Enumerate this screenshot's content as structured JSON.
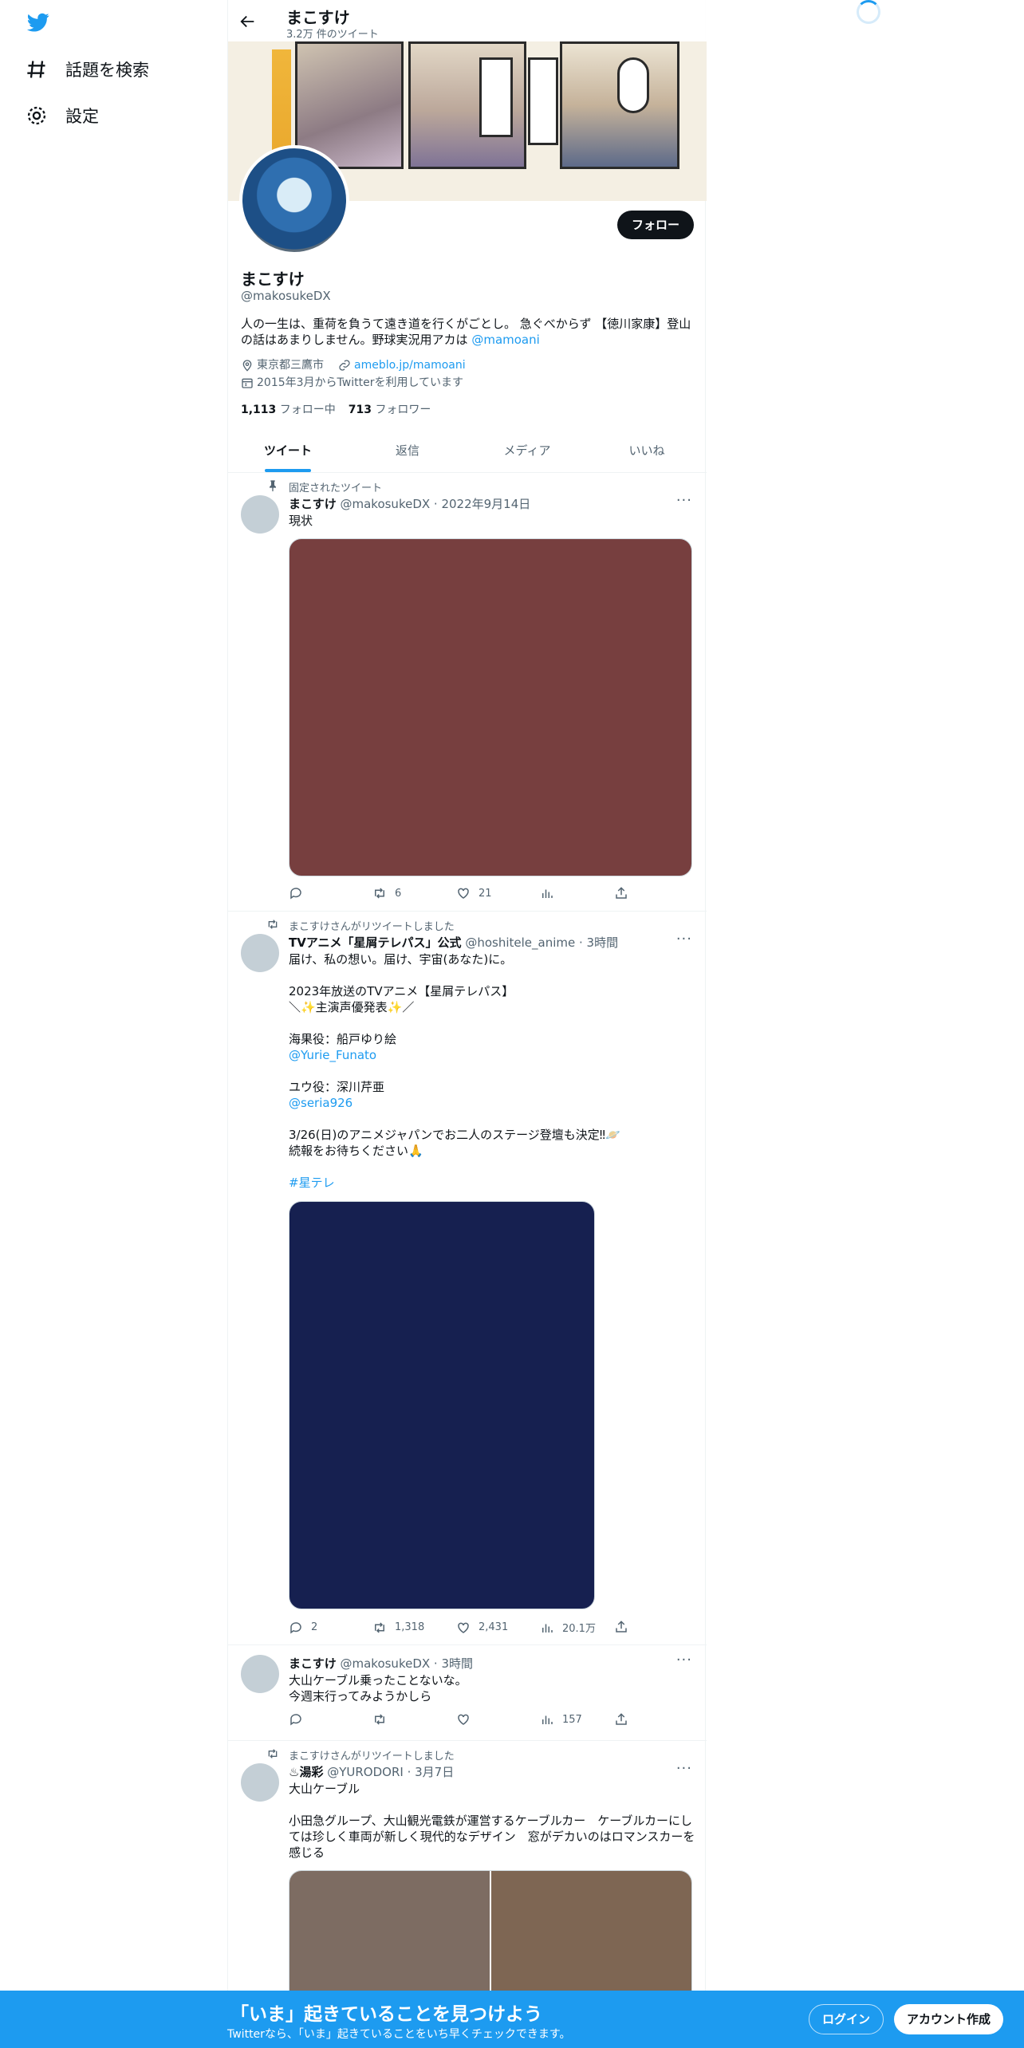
{
  "nav": {
    "items": [
      {
        "label": "話題を検索",
        "icon": "hashtag-icon"
      },
      {
        "label": "設定",
        "icon": "gear-icon"
      }
    ]
  },
  "header": {
    "name": "まこすけ",
    "tweet_count": "3.2万 件のツイート"
  },
  "profile": {
    "name": "まこすけ",
    "handle": "@makosukeDX",
    "bio": "人の一生は、重荷を負うて遠き道を行くがごとし。 急ぐべからず 【徳川家康】登山の話はあまりしません。野球実況用アカは ",
    "bio_link": "@mamoani",
    "location": "東京都三鷹市",
    "url": "ameblo.jp/mamoani",
    "joined": "2015年3月からTwitterを利用しています",
    "following_count": "1,113",
    "following_label": "フォロー中",
    "followers_count": "713",
    "followers_label": "フォロワー",
    "follow_button": "フォロー"
  },
  "tabs": [
    "ツイート",
    "返信",
    "メディア",
    "いいね"
  ],
  "tweets": [
    {
      "context": "固定されたツイート",
      "name": "まこすけ",
      "handle": "@makosukeDX",
      "date": "2022年9月14日",
      "text": "現状",
      "media_color": "#773f3f",
      "replies": "",
      "retweets": "6",
      "likes": "21",
      "views": ""
    },
    {
      "context": "まこすけさんがリツイートしました",
      "name": "TVアニメ「星屑テレパス」公式",
      "handle": "@hoshitele_anime",
      "date": "3時間",
      "text": "届け、私の想い。届け、宇宙(あなた)に。\n\n2023年放送のTVアニメ【星屑テレパス】\n＼✨主演声優発表✨／\n\n海果役：船戸ゆり絵\n",
      "link1": "@Yurie_Funato",
      "text2": "\n\nユウ役：深川芹亜\n",
      "link2": "@seria926",
      "text3": "\n\n3/26(日)のアニメジャパンでお二人のステージ登壇も決定‼🪐\n続報をお待ちください🙏\n\n",
      "hashtag": "#星テレ",
      "media_color": "#162050",
      "replies": "2",
      "retweets": "1,318",
      "likes": "2,431",
      "views": "20.1万"
    },
    {
      "context": "",
      "name": "まこすけ",
      "handle": "@makosukeDX",
      "date": "3時間",
      "text": "大山ケーブル乗ったことないな。\n今週末行ってみようかしら",
      "replies": "",
      "retweets": "",
      "likes": "",
      "views": "157"
    },
    {
      "context": "まこすけさんがリツイートしました",
      "name": "♨湯彩",
      "handle": "@YURODORI",
      "date": "3月7日",
      "text": "大山ケーブル\n\n小田急グループ、大山観光電鉄が運営するケーブルカー　ケーブルカーにしては珍しく車両が新しく現代的なデザイン　窓がデカいのはロマンスカーを感じる",
      "media_color_left": "#7d6c62",
      "media_color_right": "#7e6653"
    }
  ],
  "footer": {
    "title": "「いま」起きていることを見つけよう",
    "subtitle": "Twitterなら、「いま」起きていることをいち早くチェックできます。",
    "login": "ログイン",
    "signup": "アカウント作成"
  },
  "colors": {
    "accent": "#1d9bf0",
    "text": "#0f1419",
    "muted": "#536471"
  }
}
